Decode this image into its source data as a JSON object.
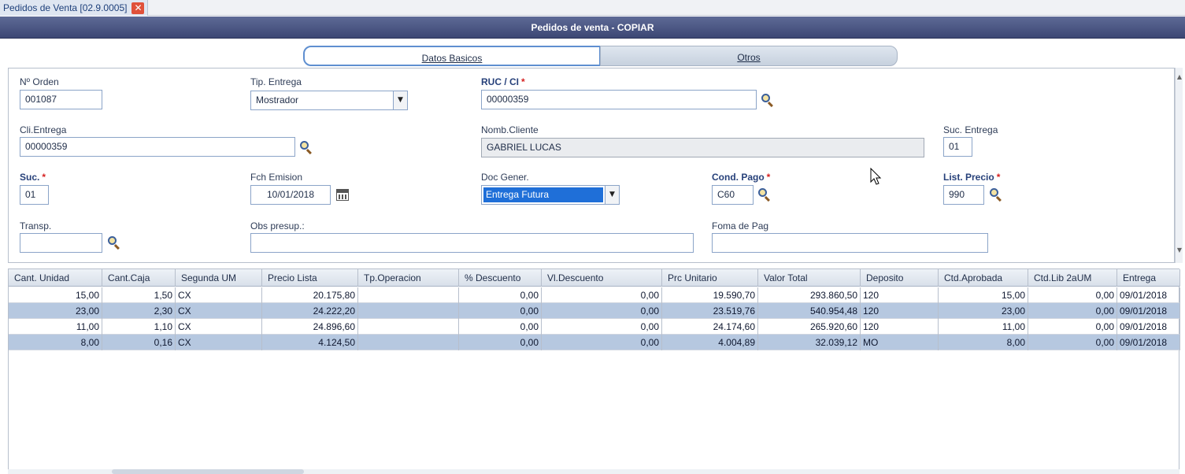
{
  "doc_tab": {
    "title": "Pedidos de Venta [02.9.0005]"
  },
  "header": {
    "title": "Pedidos de venta - COPIAR"
  },
  "subtabs": [
    "Datos Basicos",
    "Otros"
  ],
  "form": {
    "n_orden": {
      "label": "Nº Orden",
      "value": "001087"
    },
    "tip_entrega": {
      "label": "Tip. Entrega",
      "value": "Mostrador"
    },
    "ruc": {
      "label": "RUC / CI",
      "req": "*",
      "value": "00000359"
    },
    "cli_entrega": {
      "label": "Cli.Entrega",
      "value": "00000359"
    },
    "nomb_cliente": {
      "label": "Nomb.Cliente",
      "value": "GABRIEL LUCAS"
    },
    "suc_entrega": {
      "label": "Suc. Entrega",
      "value": "01"
    },
    "suc": {
      "label": "Suc.",
      "req": "*",
      "value": "01"
    },
    "fch_emision": {
      "label": "Fch Emision",
      "value": "10/01/2018"
    },
    "doc_gener": {
      "label": "Doc Gener.",
      "value": "Entrega Futura"
    },
    "cond_pago": {
      "label": "Cond. Pago",
      "req": "*",
      "value": "C60"
    },
    "list_precio": {
      "label": "List. Precio",
      "req": "*",
      "value": "990"
    },
    "transp": {
      "label": "Transp.",
      "value": ""
    },
    "obs_presup": {
      "label": "Obs presup.:",
      "value": ""
    },
    "forma_pago": {
      "label": "Foma de Pag",
      "value": ""
    }
  },
  "grid": {
    "columns": [
      "Cant. Unidad",
      "Cant.Caja",
      "Segunda UM",
      "Precio Lista",
      "Tp.Operacion",
      "% Descuento",
      "Vl.Descuento",
      "Prc Unitario",
      "Valor Total",
      "Deposito",
      "Ctd.Aprobada",
      "Ctd.Lib 2aUM",
      "Entrega"
    ],
    "rows": [
      [
        "15,00",
        "1,50",
        "CX",
        "20.175,80",
        "",
        "0,00",
        "0,00",
        "19.590,70",
        "293.860,50",
        "120",
        "15,00",
        "0,00",
        "09/01/2018"
      ],
      [
        "23,00",
        "2,30",
        "CX",
        "24.222,20",
        "",
        "0,00",
        "0,00",
        "23.519,76",
        "540.954,48",
        "120",
        "23,00",
        "0,00",
        "09/01/2018"
      ],
      [
        "11,00",
        "1,10",
        "CX",
        "24.896,60",
        "",
        "0,00",
        "0,00",
        "24.174,60",
        "265.920,60",
        "120",
        "11,00",
        "0,00",
        "09/01/2018"
      ],
      [
        "8,00",
        "0,16",
        "CX",
        "4.124,50",
        "",
        "0,00",
        "0,00",
        "4.004,89",
        "32.039,12",
        "MO",
        "8,00",
        "0,00",
        "09/01/2018"
      ]
    ]
  }
}
